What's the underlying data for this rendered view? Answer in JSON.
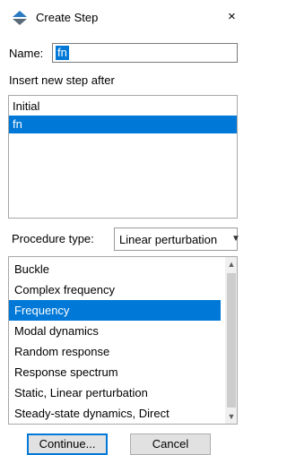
{
  "window": {
    "title": "Create Step",
    "close_glyph": "×",
    "app_icon": "create-step-icon"
  },
  "name_field": {
    "label": "Name:",
    "value": "fn"
  },
  "insert": {
    "label": "Insert new step after",
    "steps": [
      {
        "label": "Initial",
        "selected": false
      },
      {
        "label": "fn",
        "selected": true
      }
    ]
  },
  "procedure": {
    "label": "Procedure type:",
    "selected_type": "Linear perturbation",
    "items": [
      {
        "label": "Buckle",
        "selected": false
      },
      {
        "label": "Complex frequency",
        "selected": false
      },
      {
        "label": "Frequency",
        "selected": true
      },
      {
        "label": "Modal dynamics",
        "selected": false
      },
      {
        "label": "Random response",
        "selected": false
      },
      {
        "label": "Response spectrum",
        "selected": false
      },
      {
        "label": "Static, Linear perturbation",
        "selected": false
      },
      {
        "label": "Steady-state dynamics, Direct",
        "selected": false
      }
    ]
  },
  "buttons": {
    "continue": "Continue...",
    "cancel": "Cancel"
  },
  "colors": {
    "selection": "#0078d7",
    "button_face": "#e1e1e1"
  }
}
